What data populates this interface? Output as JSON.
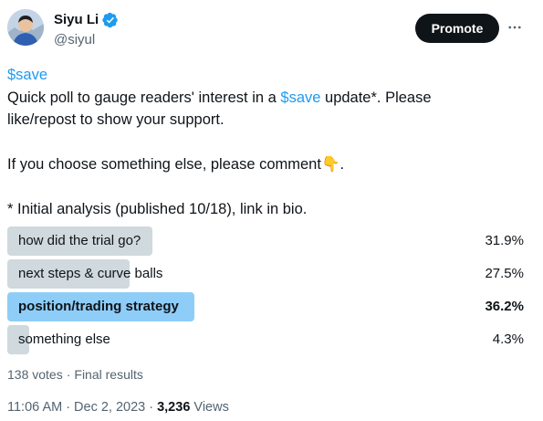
{
  "author": {
    "display_name": "Siyu Li",
    "handle": "@siyul",
    "verified_badge": "verified-badge-icon",
    "avatar": "avatar-photo"
  },
  "header": {
    "promote_label": "Promote",
    "more_icon": "more-horizontal-icon"
  },
  "post": {
    "line1_cashtag": "$save",
    "line2_before": "Quick poll to gauge readers' interest in a ",
    "line2_cashtag": "$save",
    "line2_after": " update*.  Please",
    "line3": "like/repost to show your support.",
    "line4_text": "If you choose something else, please comment",
    "line4_emoji": "👇",
    "line4_end": ".",
    "line5": "* Initial analysis (published 10/18), link in bio."
  },
  "poll": {
    "options": [
      {
        "label": "how did the trial go?",
        "percent": "31.9%",
        "value": 31.9,
        "winner": false
      },
      {
        "label": "next steps & curve balls",
        "percent": "27.5%",
        "value": 27.5,
        "winner": false
      },
      {
        "label": "position/trading strategy",
        "percent": "36.2%",
        "value": 36.2,
        "winner": true
      },
      {
        "label": "something else",
        "percent": "4.3%",
        "value": 4.3,
        "winner": false
      }
    ],
    "votes": "138 votes",
    "status": "Final results"
  },
  "timestamp": {
    "time": "11:06 AM",
    "date": "Dec 2, 2023",
    "views_count": "3,236",
    "views_label": "Views"
  },
  "colors": {
    "accent": "#1d9bf0",
    "text": "#0f1419",
    "secondary": "#536471",
    "poll_fill": "#cfd9de",
    "poll_winner_fill": "#8ecdf8",
    "button_bg": "#0f1419"
  }
}
